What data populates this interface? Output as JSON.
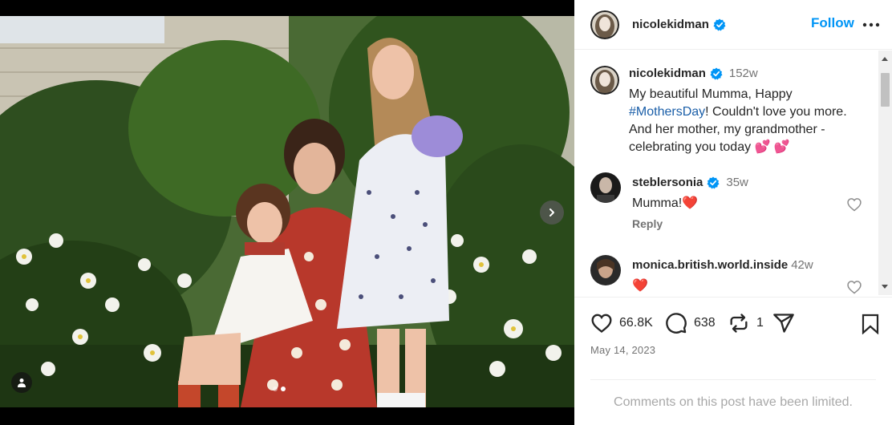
{
  "post": {
    "author": "nicolekidman",
    "follow_label": "Follow",
    "more_label": "More options",
    "caption": {
      "time": "152w",
      "text_before": "My beautiful Mumma, Happy ",
      "hashtag": "#MothersDay",
      "text_after": "! Couldn't love you more. And her mother, my grandmother - celebrating you today 💕 💕"
    },
    "comments": [
      {
        "user": "steblersonia",
        "verified": true,
        "time": "35w",
        "text": "Mumma!❤️",
        "reply_label": "Reply"
      },
      {
        "user": "monica.british.world.inside",
        "verified": false,
        "time": "42w",
        "text": "❤️"
      }
    ],
    "likes": "66.8K",
    "comment_count": "638",
    "repost_count": "1",
    "date": "May 14, 2023",
    "limited_notice": "Comments on this post have been limited."
  },
  "media": {
    "slide_count": 2,
    "active_slide": 2
  },
  "colors": {
    "accent": "#0095f6",
    "verified": "#0095f6",
    "hashtag": "#1a5ea8",
    "muted": "#737373"
  },
  "icons": [
    "verified-badge-icon",
    "more-icon",
    "heart-icon",
    "comment-icon",
    "repost-icon",
    "share-icon",
    "bookmark-icon",
    "chevron-right-icon",
    "tag-user-icon"
  ]
}
